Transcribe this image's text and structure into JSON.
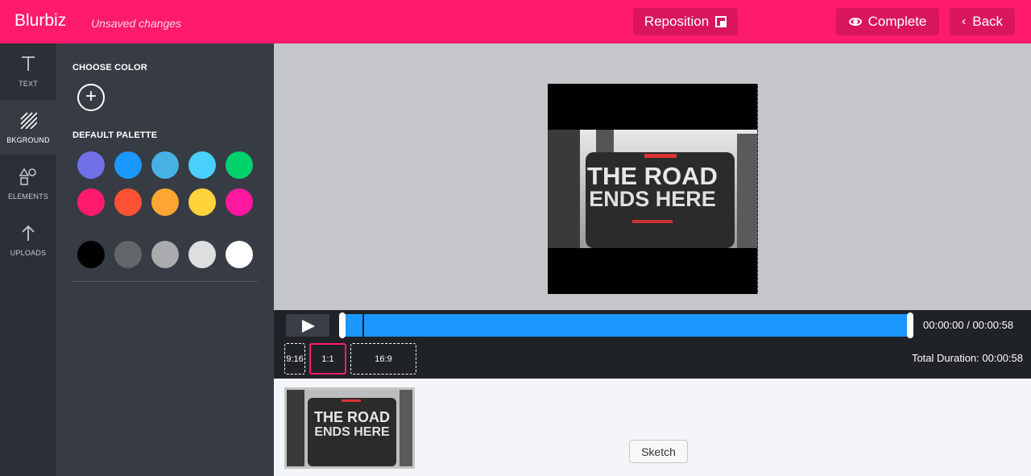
{
  "header": {
    "brand": "Blurbiz",
    "status": "Unsaved changes",
    "reposition_label": "Reposition",
    "complete_label": "Complete",
    "back_label": "Back"
  },
  "rail": [
    {
      "label": "TEXT",
      "icon": "text-icon"
    },
    {
      "label": "BKGROUND",
      "icon": "background-icon"
    },
    {
      "label": "ELEMENTS",
      "icon": "elements-icon"
    },
    {
      "label": "UPLOADS",
      "icon": "upload-icon"
    }
  ],
  "panel": {
    "choose_color": "CHOOSE COLOR",
    "default_palette": "DEFAULT PALETTE",
    "colors": [
      [
        "#7170e8",
        "#1a98ff",
        "#45b2e3",
        "#4ad0ff",
        "#00d26b"
      ],
      [
        "#ff1b6b",
        "#ff5133",
        "#ffa632",
        "#ffd43b",
        "#ff17a0"
      ],
      [
        "#000000",
        "#646669",
        "#a9abaf",
        "#dcdee0",
        "#ffffff"
      ]
    ]
  },
  "video": {
    "headline_line1": "THE ROAD",
    "headline_line2": "ENDS HERE"
  },
  "timeline": {
    "time": "00:00:00 / 00:00:58",
    "total": "Total Duration: 00:00:58",
    "ratios": [
      "9:16",
      "1:1",
      "16:9"
    ],
    "selected_ratio": "1:1"
  },
  "filmstrip": {
    "tooltip": "Sketch",
    "thumb_line1": "THE ROAD",
    "thumb_line2": "ENDS HERE"
  }
}
